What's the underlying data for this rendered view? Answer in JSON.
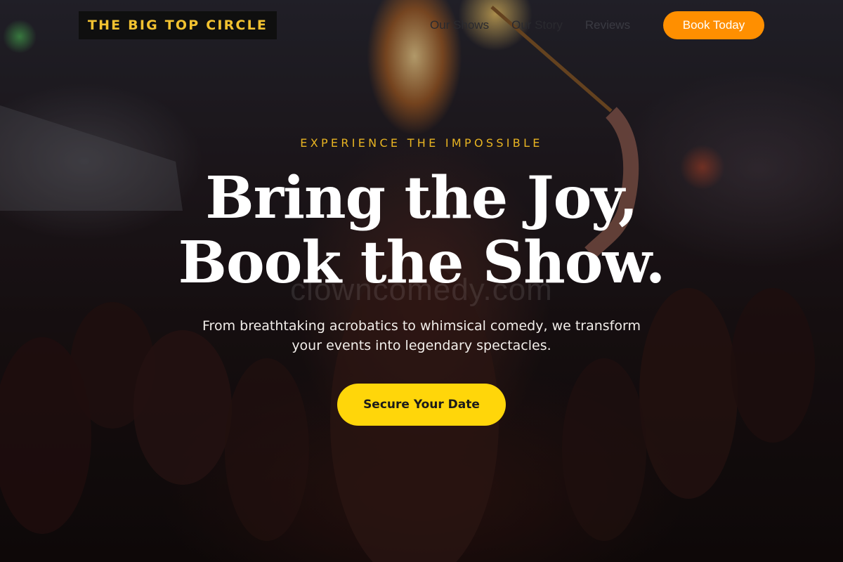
{
  "header": {
    "logo_text": "THE BIG TOP CIRCLE",
    "nav": [
      {
        "label": "Our Shows"
      },
      {
        "label": "Our Story"
      },
      {
        "label": "Reviews"
      }
    ],
    "cta_label": "Book Today"
  },
  "hero": {
    "eyebrow": "EXPERIENCE THE IMPOSSIBLE",
    "headline_line1": "Bring the Joy,",
    "headline_line2": "Book the Show.",
    "watermark": "clowncomedy.com",
    "subtext_line1": "From breathtaking acrobatics to whimsical comedy, we transform",
    "subtext_line2": "your events into legendary spectacles.",
    "cta_label": "Secure Your Date",
    "background_image": "fire-performer-crowd-photo"
  },
  "colors": {
    "logo_text": "#f2c230",
    "logo_bg": "#0f0f0f",
    "book_button": "#ff8f00",
    "cta_button": "#ffd60a",
    "eyebrow": "#e8b422",
    "headline": "#ffffff"
  }
}
